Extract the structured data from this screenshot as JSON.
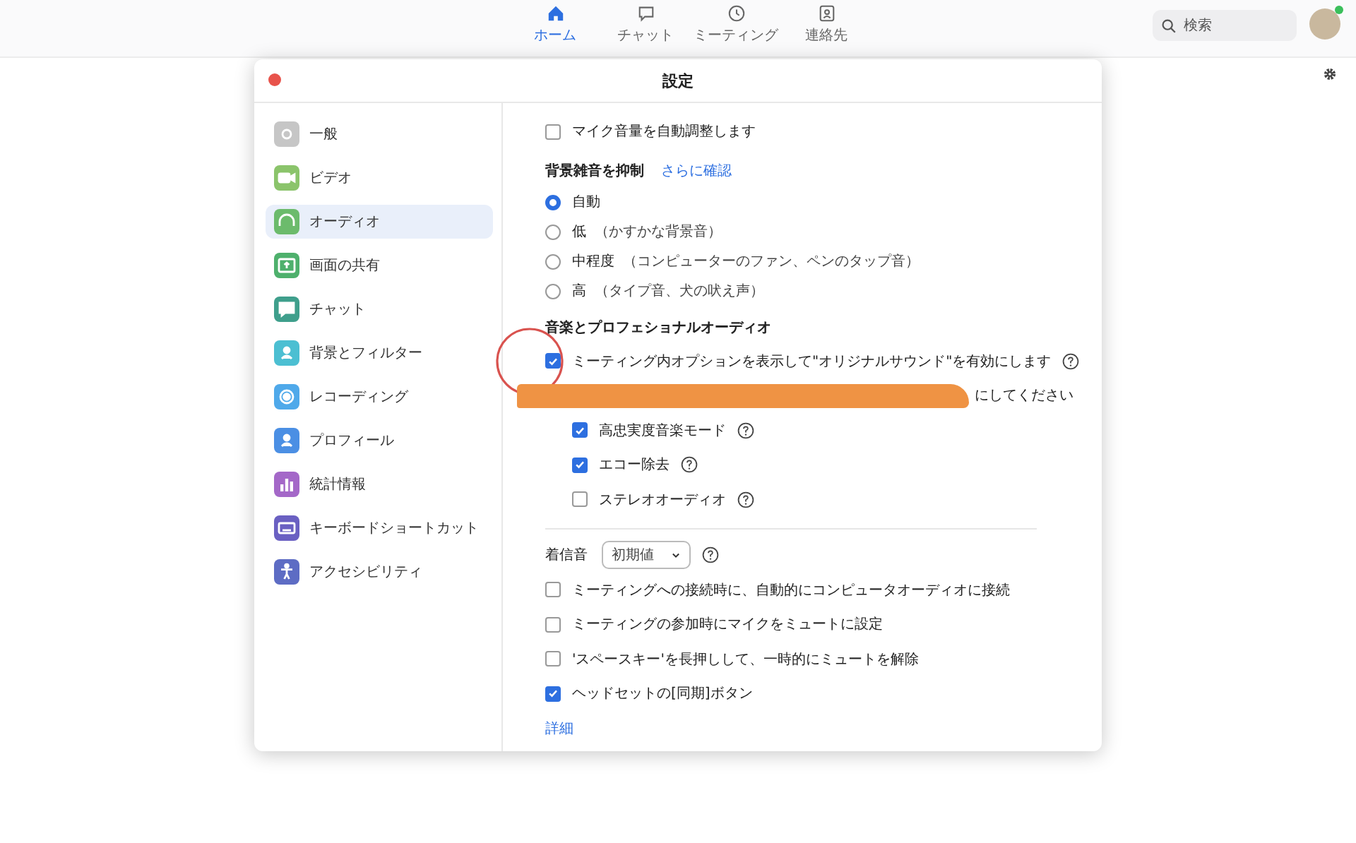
{
  "top_nav": {
    "tabs": [
      {
        "label": "ホーム",
        "kind": "home",
        "selected": true
      },
      {
        "label": "チャット",
        "kind": "chat",
        "selected": false
      },
      {
        "label": "ミーティング",
        "kind": "clock",
        "selected": false
      },
      {
        "label": "連絡先",
        "kind": "contact",
        "selected": false
      }
    ],
    "search": {
      "placeholder": "検索"
    }
  },
  "settings": {
    "title": "設定",
    "sidebar": {
      "items": [
        {
          "label": "一般",
          "kind": "gear",
          "color": "#c6c6c6",
          "selected": false
        },
        {
          "label": "ビデオ",
          "kind": "video",
          "color": "#8bc46b",
          "selected": false
        },
        {
          "label": "オーディオ",
          "kind": "headphones",
          "color": "#6cbb6c",
          "selected": true
        },
        {
          "label": "画面の共有",
          "kind": "share",
          "color": "#4eb06c",
          "selected": false
        },
        {
          "label": "チャット",
          "kind": "chat",
          "color": "#3f9f8c",
          "selected": false
        },
        {
          "label": "背景とフィルター",
          "kind": "person",
          "color": "#4cbfd2",
          "selected": false
        },
        {
          "label": "レコーディング",
          "kind": "record",
          "color": "#4fa9ea",
          "selected": false
        },
        {
          "label": "プロフィール",
          "kind": "person",
          "color": "#4b8fe4",
          "selected": false
        },
        {
          "label": "統計情報",
          "kind": "stats",
          "color": "#a468c8",
          "selected": false
        },
        {
          "label": "キーボードショートカット",
          "kind": "keyboard",
          "color": "#6a60c2",
          "selected": false
        },
        {
          "label": "アクセシビリティ",
          "kind": "access",
          "color": "#5d6cc4",
          "selected": false
        }
      ]
    },
    "content": [
      {
        "kind": "checkbox",
        "label": "マイク音量を自動調整します",
        "checked": false,
        "help": false
      },
      {
        "kind": "heading",
        "label": "背景雑音を抑制",
        "link": "さらに確認"
      },
      {
        "kind": "radio",
        "label": "自動",
        "selected": true
      },
      {
        "kind": "radio",
        "label": "低",
        "note": "（かすかな背景音）",
        "selected": false
      },
      {
        "kind": "radio",
        "label": "中程度",
        "note": "（コンピューターのファン、ペンのタップ音）",
        "selected": false
      },
      {
        "kind": "radio",
        "label": "高",
        "note": "（タイプ音、犬の吠え声）",
        "selected": false
      },
      {
        "kind": "heading",
        "label": "音楽とプロフェショナルオーディオ"
      },
      {
        "kind": "checkbox",
        "label": "ミーティング内オプションを表示して\"オリジナルサウンド\"を有効にします",
        "checked": true,
        "help": true,
        "circled": true
      },
      {
        "kind": "redacted",
        "tail": "にしてください"
      },
      {
        "kind": "checkbox",
        "label": "高忠実度音楽モード",
        "checked": true,
        "help": true,
        "indent": true
      },
      {
        "kind": "checkbox",
        "label": "エコー除去",
        "checked": true,
        "help": true,
        "indent": true
      },
      {
        "kind": "checkbox",
        "label": "ステレオオーディオ",
        "checked": false,
        "help": true,
        "indent": true
      },
      {
        "kind": "divider"
      },
      {
        "kind": "select",
        "label": "着信音",
        "value": "初期値",
        "help": true
      },
      {
        "kind": "checkbox",
        "label": "ミーティングへの接続時に、自動的にコンピュータオーディオに接続",
        "checked": false,
        "help": false
      },
      {
        "kind": "checkbox",
        "label": "ミーティングの参加時にマイクをミュートに設定",
        "checked": false,
        "help": false
      },
      {
        "kind": "checkbox",
        "label": "'スペースキー'を長押しして、一時的にミュートを解除",
        "checked": false,
        "help": false
      },
      {
        "kind": "checkbox",
        "label": "ヘッドセットの[同期]ボタン",
        "checked": true,
        "help": false
      },
      {
        "kind": "link",
        "label": "詳細"
      }
    ]
  }
}
